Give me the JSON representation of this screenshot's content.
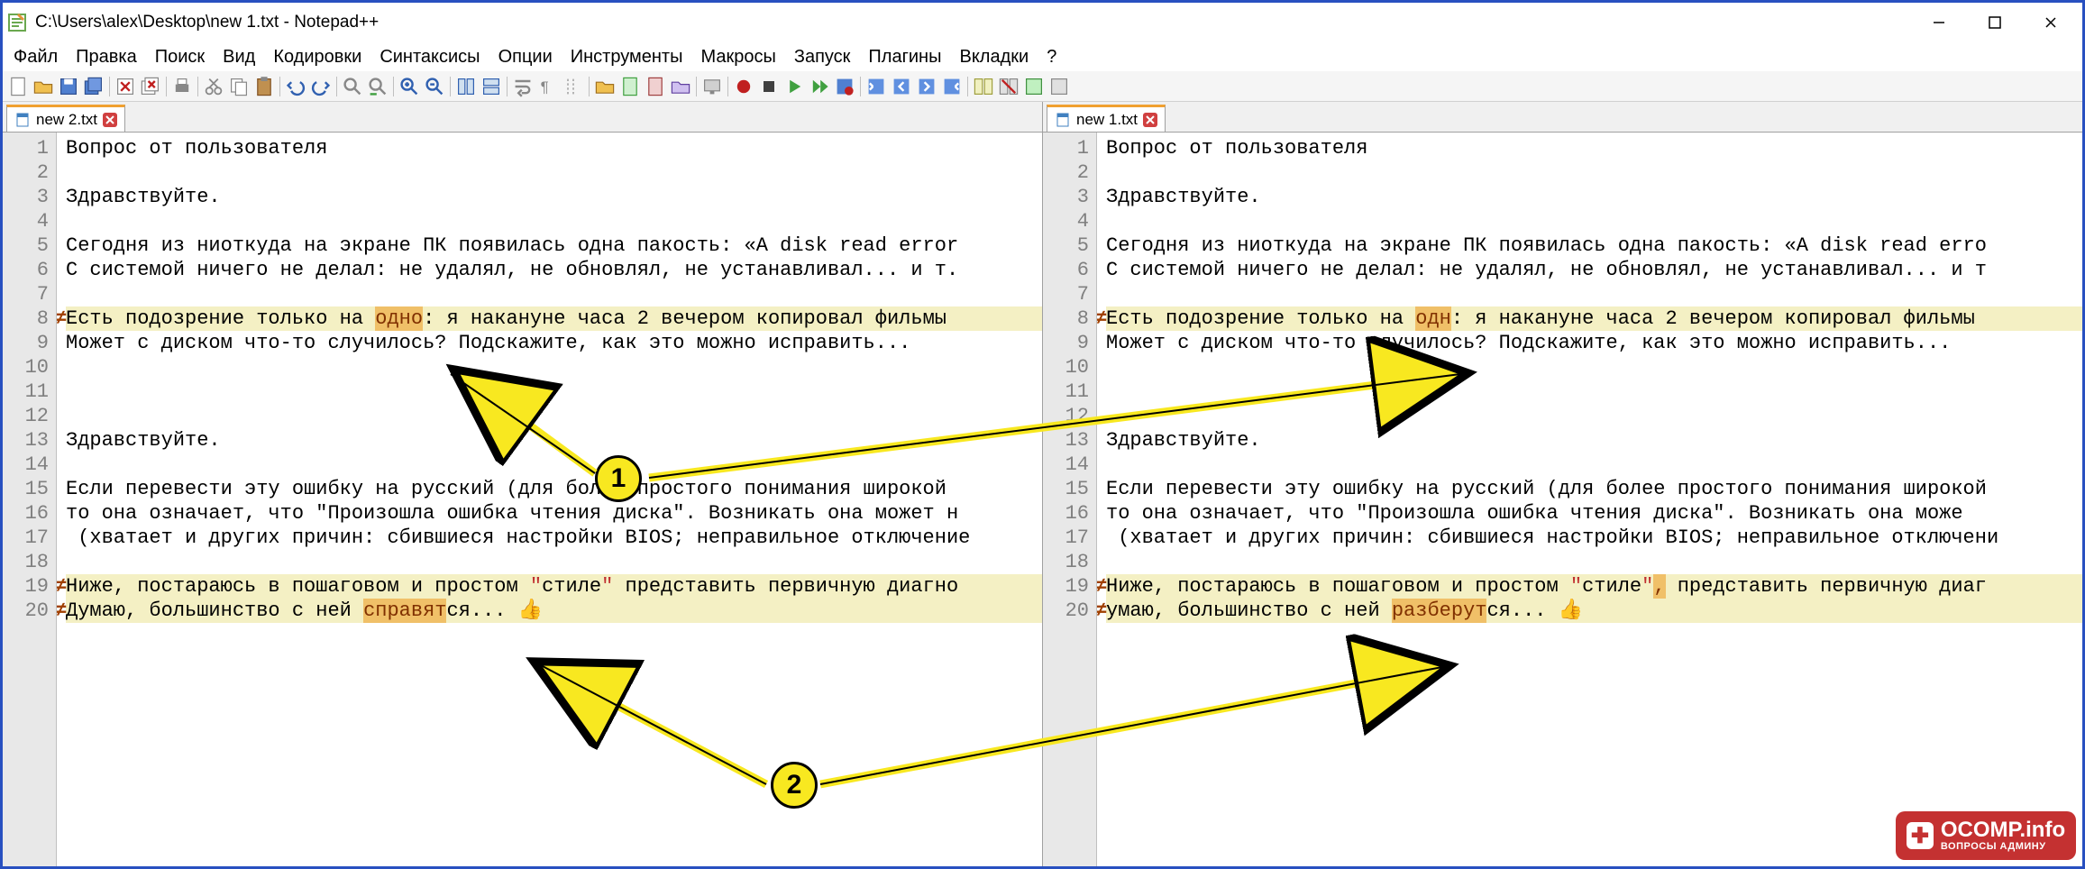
{
  "window": {
    "title": "C:\\Users\\alex\\Desktop\\new 1.txt - Notepad++"
  },
  "menu": {
    "file": "Файл",
    "edit": "Правка",
    "search": "Поиск",
    "view": "Вид",
    "encoding": "Кодировки",
    "syntax": "Синтаксисы",
    "options": "Опции",
    "tools": "Инструменты",
    "macro": "Макросы",
    "run": "Запуск",
    "plugins": "Плагины",
    "tabs": "Вкладки",
    "help": "?"
  },
  "panes": {
    "left": {
      "tab": "new 2.txt"
    },
    "right": {
      "tab": "new 1.txt"
    }
  },
  "lines_left": [
    {
      "n": "1",
      "t": "Вопрос от пользователя"
    },
    {
      "n": "2",
      "t": ""
    },
    {
      "n": "3",
      "t": "Здравствуйте."
    },
    {
      "n": "4",
      "t": ""
    },
    {
      "n": "5",
      "t": "Сегодня из ниоткуда на экране ПК появилась одна пакость: «A disk read error"
    },
    {
      "n": "6",
      "t": "С системой ничего не делал: не удалял, не обновлял, не устанавливал... и т."
    },
    {
      "n": "7",
      "t": ""
    },
    {
      "n": "8",
      "diff": true,
      "pre": "Есть подозрение только на ",
      "hl": "одно",
      "post": ": я накануне часа 2 вечером копировал фильмы"
    },
    {
      "n": "9",
      "t": "Может с диском что-то случилось? Подскажите, как это можно исправить..."
    },
    {
      "n": "10",
      "t": ""
    },
    {
      "n": "11",
      "t": ""
    },
    {
      "n": "12",
      "t": ""
    },
    {
      "n": "13",
      "t": "Здравствуйте."
    },
    {
      "n": "14",
      "t": ""
    },
    {
      "n": "15",
      "t": "Если перевести эту ошибку на русский (для более простого понимания широкой "
    },
    {
      "n": "16",
      "t": "то она означает, что \"Произошла ошибка чтения диска\". Возникать она может н"
    },
    {
      "n": "17",
      "t": " (хватает и других причин: сбившиеся настройки BIOS; неправильное отключение"
    },
    {
      "n": "18",
      "t": ""
    },
    {
      "n": "19",
      "diff": true,
      "pre": "Ниже, постараюсь в пошаговом и простом ",
      "q1": "\"",
      "mid": "стиле",
      "q2": "\"",
      "post": " представить первичную диагно"
    },
    {
      "n": "20",
      "diff": true,
      "pre2": "Думаю, большинство с ней ",
      "hl": "справят",
      "post2": "ся... 👍"
    }
  ],
  "lines_right": [
    {
      "n": "1",
      "t": "Вопрос от пользователя"
    },
    {
      "n": "2",
      "t": ""
    },
    {
      "n": "3",
      "t": "Здравствуйте."
    },
    {
      "n": "4",
      "t": ""
    },
    {
      "n": "5",
      "t": "Сегодня из ниоткуда на экране ПК появилась одна пакость: «A disk read erro"
    },
    {
      "n": "6",
      "t": "С системой ничего не делал: не удалял, не обновлял, не устанавливал... и т"
    },
    {
      "n": "7",
      "t": ""
    },
    {
      "n": "8",
      "diff": true,
      "pre": "Есть подозрение только на ",
      "hl": "одн",
      "post": ": я накануне часа 2 вечером копировал фильмы "
    },
    {
      "n": "9",
      "t": "Может с диском что-то случилось? Подскажите, как это можно исправить..."
    },
    {
      "n": "10",
      "t": ""
    },
    {
      "n": "11",
      "t": ""
    },
    {
      "n": "12",
      "t": ""
    },
    {
      "n": "13",
      "t": "Здравствуйте."
    },
    {
      "n": "14",
      "t": ""
    },
    {
      "n": "15",
      "t": "Если перевести эту ошибку на русский (для более простого понимания широкой"
    },
    {
      "n": "16",
      "t": "то она означает, что \"Произошла ошибка чтения диска\". Возникать она може"
    },
    {
      "n": "17",
      "t": " (хватает и других причин: сбившиеся настройки BIOS; неправильное отключени"
    },
    {
      "n": "18",
      "t": ""
    },
    {
      "n": "19",
      "diff": true,
      "pre": "Ниже, постараюсь в пошаговом и простом ",
      "q1": "\"",
      "mid": "стиле",
      "q2": "\"",
      "comma": ",",
      "post": " представить первичную диаг"
    },
    {
      "n": "20",
      "diff": true,
      "pre2": "умаю, большинство с ней ",
      "hl": "разберут",
      "post2": "ся... 👍"
    }
  ],
  "annotations": {
    "badge1": "1",
    "badge2": "2"
  },
  "watermark": {
    "text": "OCOMP.info",
    "sub": "ВОПРОСЫ АДМИНУ"
  }
}
